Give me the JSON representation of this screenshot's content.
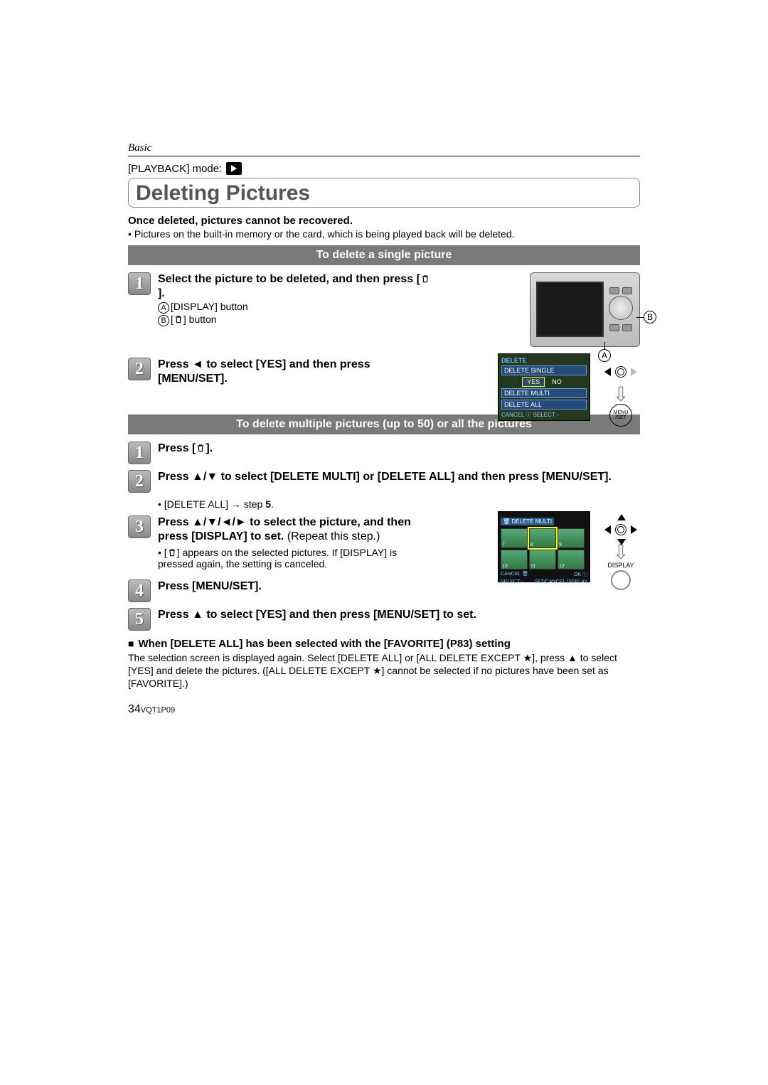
{
  "header": {
    "section": "Basic",
    "mode_label": "[PLAYBACK] mode:",
    "title": "Deleting Pictures"
  },
  "intro": {
    "warning": "Once deleted, pictures cannot be recovered.",
    "note": "Pictures on the built-in memory or the card, which is being played back will be deleted."
  },
  "single": {
    "heading": "To delete a single picture",
    "step1": {
      "num": "1",
      "text_a": "Select the picture to be deleted, and then press [",
      "text_b": "].",
      "sub_a_letter": "A",
      "sub_a_text": "[DISPLAY] button",
      "sub_b_letter": "B",
      "sub_b_prefix": "[",
      "sub_b_suffix": "] button"
    },
    "step2": {
      "num": "2",
      "text": "Press ◄ to select [YES] and then press [MENU/SET]."
    },
    "camera_callouts": {
      "a": "A",
      "b": "B"
    },
    "menu": {
      "top": "DELETE",
      "line1": "DELETE SINGLE",
      "yes": "YES",
      "no": "NO",
      "line2": "DELETE MULTI",
      "line3": "DELETE ALL",
      "cancel": "CANCEL ⓘ SELECT ◦"
    },
    "menuset": {
      "line1": "MENU",
      "line2": "/SET"
    }
  },
  "multi": {
    "heading": "To delete multiple pictures (up to 50) or all the pictures",
    "step1": {
      "num": "1",
      "text_a": "Press [",
      "text_b": "]."
    },
    "step2": {
      "num": "2",
      "text": "Press ▲/▼ to select [DELETE MULTI] or [DELETE ALL] and then press [MENU/SET]."
    },
    "delete_all_note_a": "[DELETE ALL]",
    "delete_all_note_b": "step ",
    "delete_all_note_c": "5",
    "delete_all_note_d": ".",
    "step3": {
      "num": "3",
      "text_a": "Press ▲/▼/◄/► to select the picture, and then press [DISPLAY] to set. ",
      "text_b": "(Repeat this step.)",
      "note_a": "[",
      "note_b": "] appears on the selected pictures. If [DISPLAY] is pressed again, the setting is canceled."
    },
    "multi_screen": {
      "title": "🗑 DELETE MULTI",
      "nums": [
        "7",
        "8",
        "9",
        "10",
        "11",
        "12"
      ],
      "btm_left": "CANCEL 🗑",
      "btm_right": "OK ⓘ",
      "btm2_left": "SELECT ◦",
      "btm2_right": "SET/CANCEL DISPLAY"
    },
    "display_label": "DISPLAY",
    "step4": {
      "num": "4",
      "text": "Press [MENU/SET]."
    },
    "step5": {
      "num": "5",
      "text": "Press ▲ to select [YES] and then press [MENU/SET] to set."
    }
  },
  "favorite": {
    "heading": "When [DELETE ALL] has been selected with the [FAVORITE] (P83) setting",
    "body_a": "The selection screen is displayed again. Select [DELETE ALL] or [ALL DELETE EXCEPT ",
    "body_b": "], press ▲ to select [YES] and delete the pictures. ([ALL DELETE EXCEPT ",
    "body_c": "] cannot be selected if no pictures have been set as [FAVORITE].)"
  },
  "footer": {
    "page": "34",
    "code": "VQT1P09"
  }
}
